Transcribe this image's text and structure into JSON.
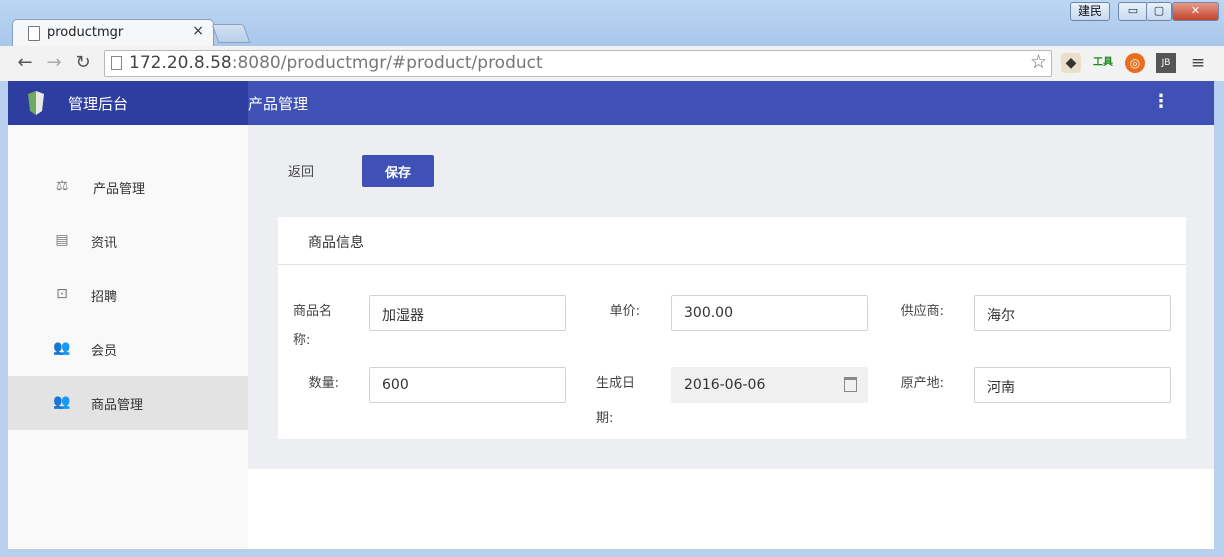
{
  "browser": {
    "tab_title": "productmgr",
    "tab_close": "×",
    "url_host": "172.20.8.58",
    "url_rest": ":8080/productmgr/#product/product",
    "user_badge": "建民",
    "win_min": "▭",
    "win_max": "▢",
    "win_close": "✕",
    "ext_tool_label": "工具"
  },
  "header": {
    "brand_name": "管理后台",
    "page_title": "产品管理",
    "menu_glyph": "⋮"
  },
  "sidebar": {
    "items": [
      {
        "label": "产品管理",
        "icon": "scale-icon",
        "glyph": "⚖"
      },
      {
        "label": "资讯",
        "icon": "newspaper-icon",
        "glyph": "▤"
      },
      {
        "label": "招聘",
        "icon": "recruit-icon",
        "glyph": "⊡"
      },
      {
        "label": "会员",
        "icon": "users-icon",
        "glyph": "👥"
      },
      {
        "label": "商品管理",
        "icon": "users-icon",
        "glyph": "👥"
      }
    ],
    "active_index": 4
  },
  "actions": {
    "back_label": "返回",
    "save_label": "保存"
  },
  "card": {
    "title": "商品信息",
    "fields": {
      "name": {
        "label_line1": "商品名",
        "label_line2": "称:",
        "value": "加湿器"
      },
      "price": {
        "label": "单价:",
        "value": "300.00"
      },
      "supplier": {
        "label": "供应商:",
        "value": "海尔"
      },
      "quantity": {
        "label": "数量:",
        "value": "600"
      },
      "date": {
        "label_line1": "生成日",
        "label_line2": "期:",
        "value": "2016-06-06"
      },
      "origin": {
        "label": "原产地:",
        "value": "河南"
      }
    }
  },
  "colors": {
    "primary": "#3f51b5",
    "brand_bg": "#2e3ea0",
    "content_bg": "#eceef1"
  }
}
